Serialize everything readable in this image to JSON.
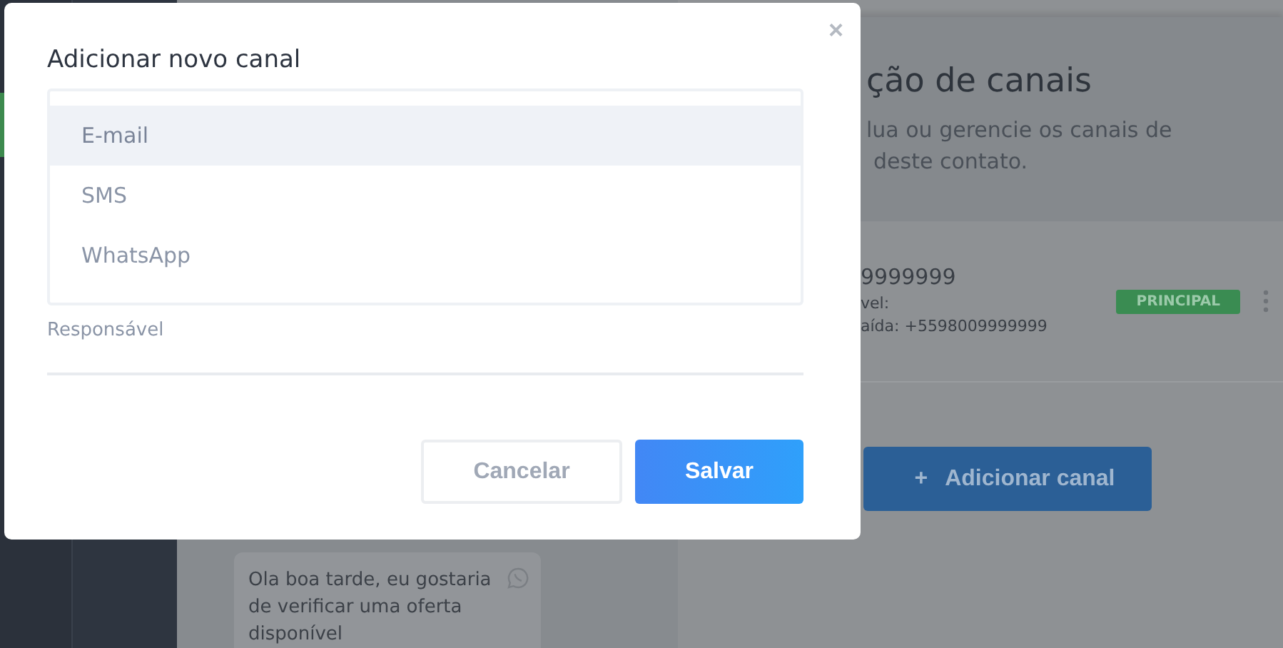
{
  "background": {
    "panel": {
      "title": "ção de canais",
      "description": "lua ou gerencie os canais de",
      "description_2": "deste contato.",
      "channel": {
        "number": "9999999",
        "line_1": "vel:",
        "line_2": "aída: +5598009999999",
        "badge": "PRINCIPAL"
      },
      "add_button": {
        "icon": "+",
        "label": "Adicionar canal"
      }
    },
    "chat": {
      "messages": [
        {
          "text": "Ola boa tarde, eu gostaria de verificar uma oferta disponível"
        }
      ]
    }
  },
  "dialog": {
    "title": "Adicionar novo canal",
    "close": "×",
    "options": [
      {
        "label": "E-mail",
        "selected": true
      },
      {
        "label": "SMS",
        "selected": false
      },
      {
        "label": "WhatsApp",
        "selected": false
      }
    ],
    "responsible": {
      "label": "Responsável"
    },
    "buttons": [
      {
        "label": "Cancelar",
        "kind": "secondary"
      },
      {
        "label": "Salvar",
        "kind": "primary"
      }
    ]
  }
}
